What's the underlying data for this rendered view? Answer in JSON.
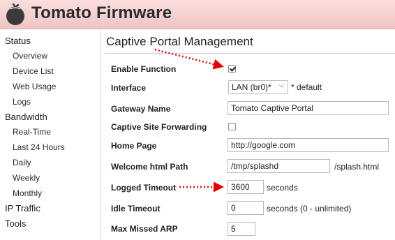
{
  "app": {
    "title": "Tomato Firmware",
    "logo_icon": "tomato-icon"
  },
  "sidebar": {
    "items": [
      {
        "label": "Status",
        "level": 0
      },
      {
        "label": "Overview",
        "level": 1
      },
      {
        "label": "Device List",
        "level": 1
      },
      {
        "label": "Web Usage",
        "level": 1
      },
      {
        "label": "Logs",
        "level": 1
      },
      {
        "label": "Bandwidth",
        "level": 0
      },
      {
        "label": "Real-Time",
        "level": 1
      },
      {
        "label": "Last 24 Hours",
        "level": 1
      },
      {
        "label": "Daily",
        "level": 1
      },
      {
        "label": "Weekly",
        "level": 1
      },
      {
        "label": "Monthly",
        "level": 1
      },
      {
        "label": "IP Traffic",
        "level": 0
      },
      {
        "label": "Tools",
        "level": 0
      }
    ]
  },
  "section": {
    "title": "Captive Portal Management"
  },
  "form": {
    "enable_function": {
      "label": "Enable Function",
      "checked": true
    },
    "interface": {
      "label": "Interface",
      "value": "LAN (br0)*",
      "note": "* default"
    },
    "gateway_name": {
      "label": "Gateway Name",
      "value": "Tomato Captive Portal"
    },
    "site_forwarding": {
      "label": "Captive Site Forwarding",
      "checked": false
    },
    "home_page": {
      "label": "Home Page",
      "value": "http://google.com"
    },
    "welcome_path": {
      "label": "Welcome html Path",
      "value": "/tmp/splashd",
      "suffix": "/splash.html"
    },
    "logged_timeout": {
      "label": "Logged Timeout",
      "value": "3600",
      "unit": "seconds"
    },
    "idle_timeout": {
      "label": "Idle Timeout",
      "value": "0",
      "unit": "seconds (0 - unlimited)"
    },
    "max_missed_arp": {
      "label": "Max Missed ARP",
      "value": "5"
    }
  },
  "colors": {
    "header_bg": "#f4d0d0",
    "annotation_arrow": "#e00000"
  }
}
